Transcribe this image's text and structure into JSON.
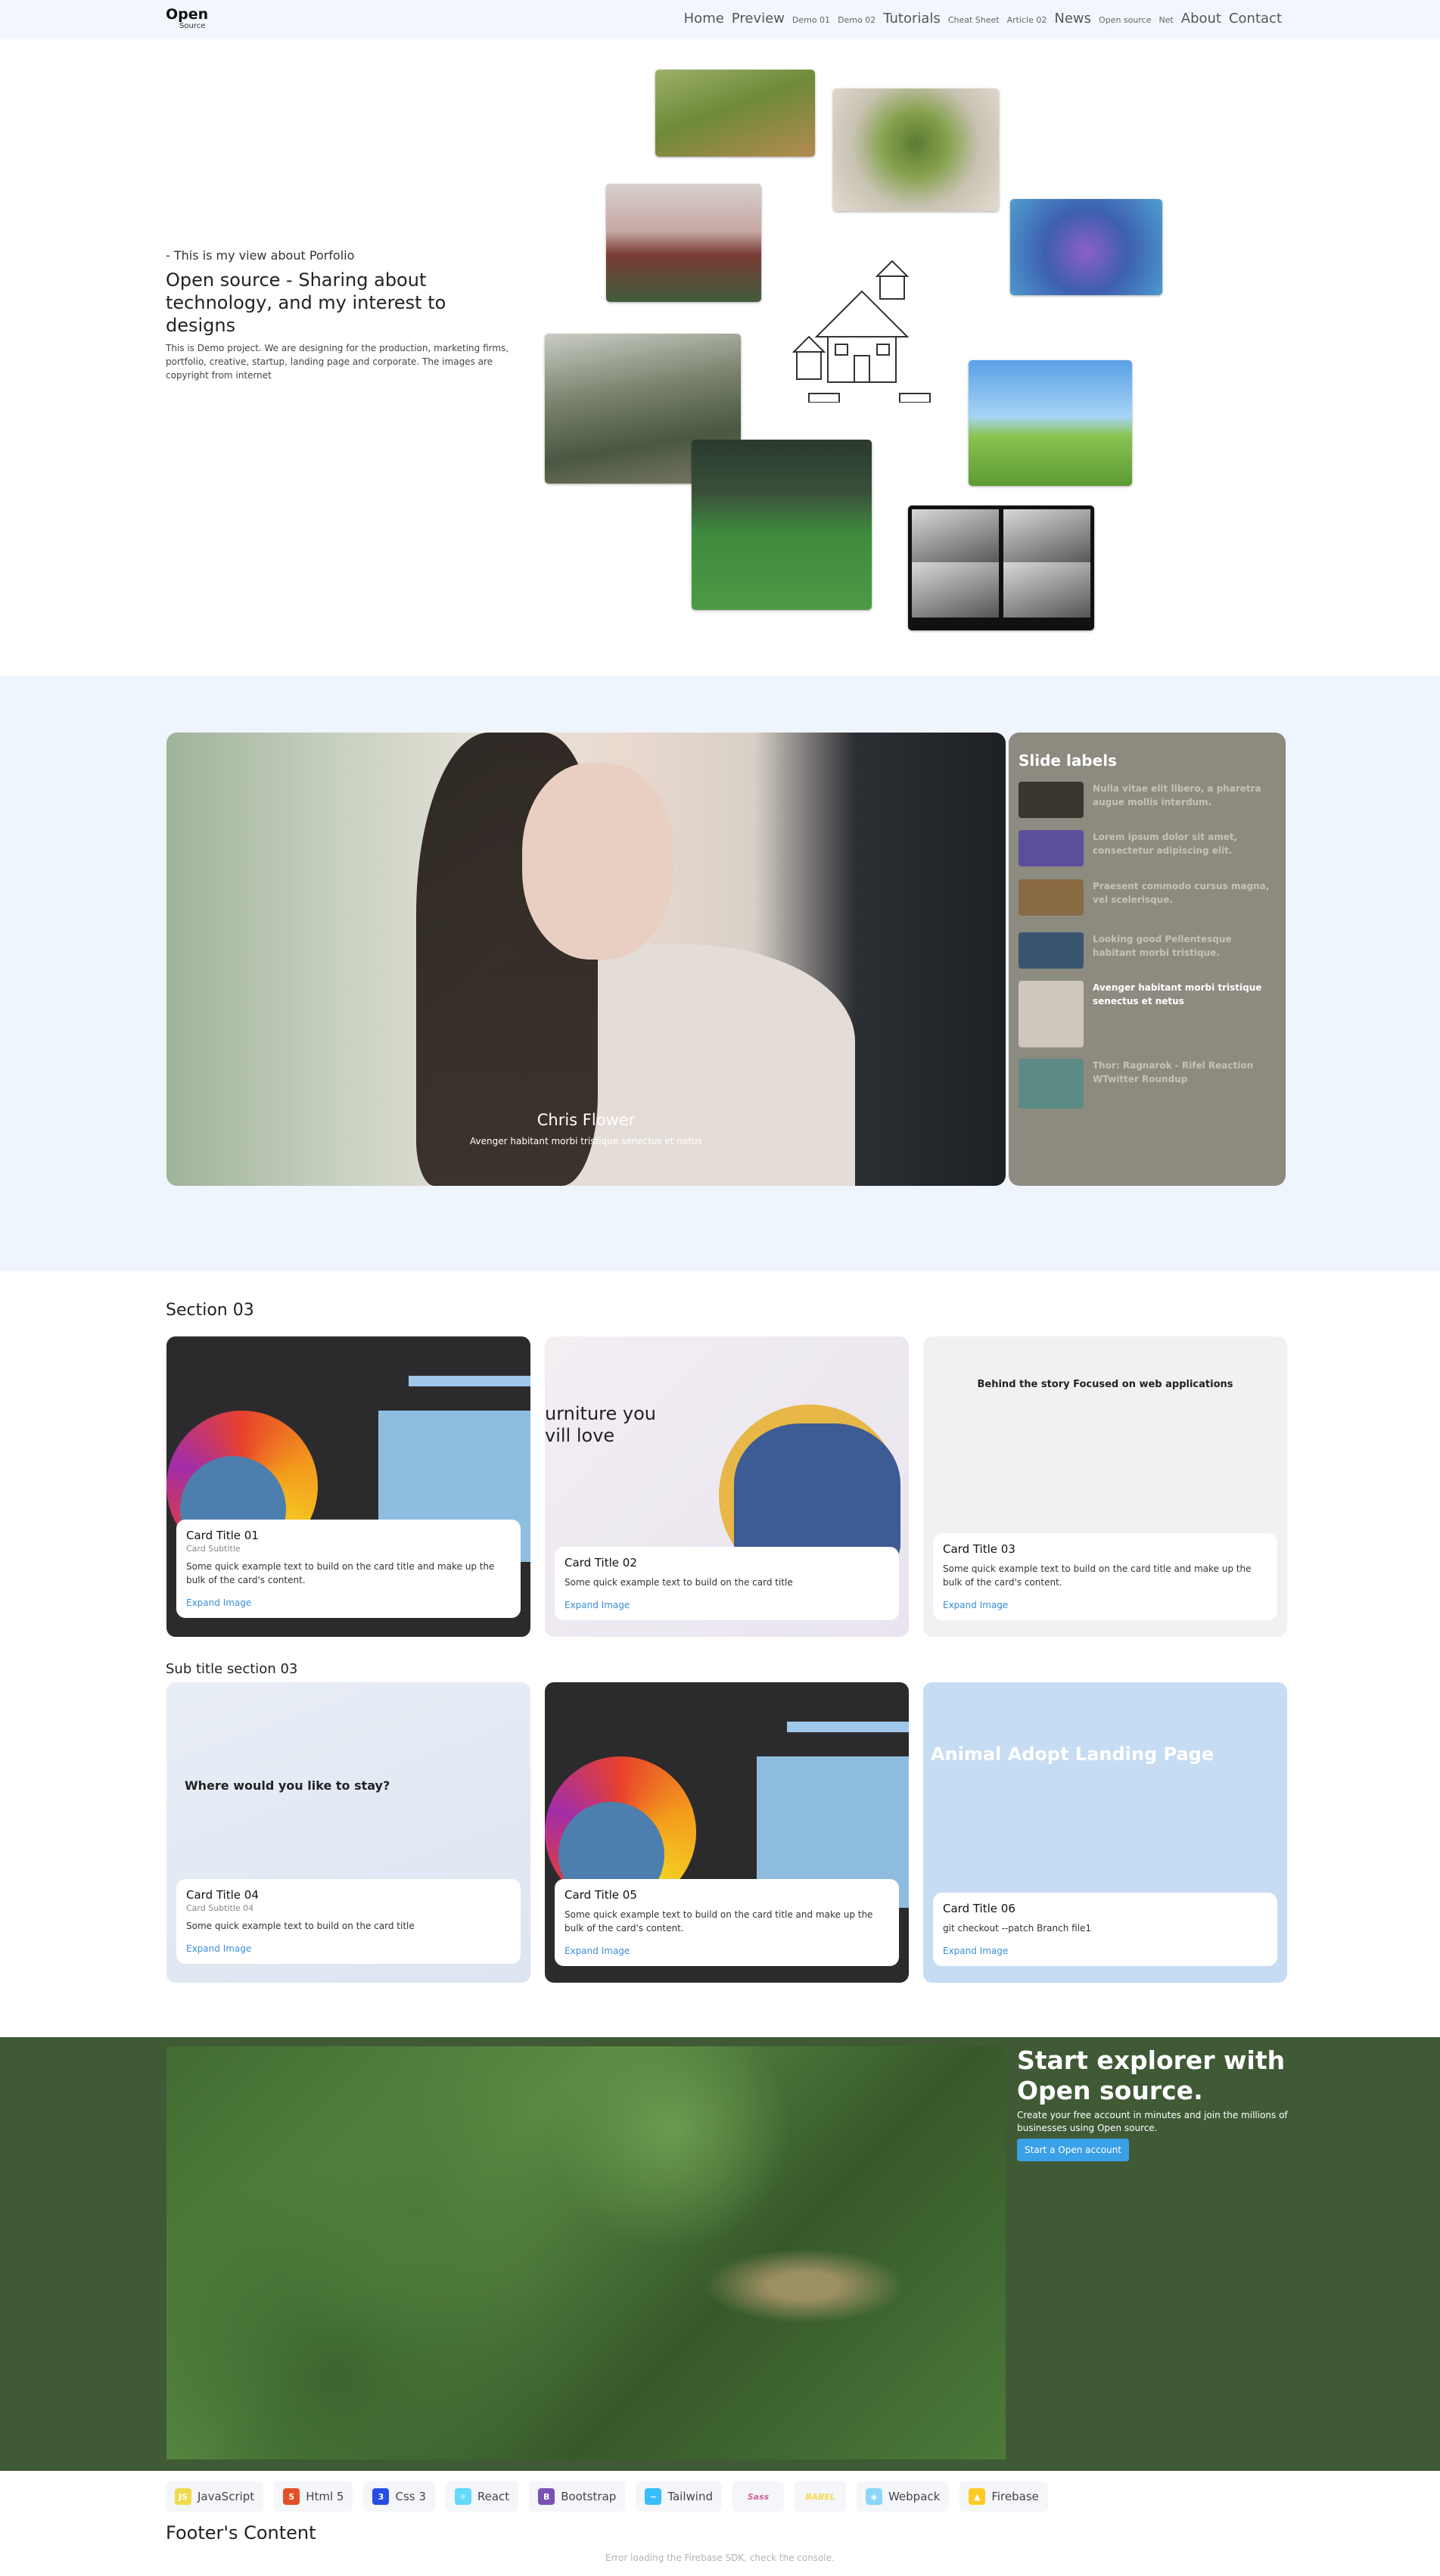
{
  "nav": {
    "logo_top": "Open",
    "logo_bottom": "Source",
    "items": [
      {
        "label": "Home",
        "size": "big"
      },
      {
        "label": "Preview",
        "size": "big"
      },
      {
        "label": "Demo 01",
        "size": "sm"
      },
      {
        "label": "Demo 02",
        "size": "sm"
      },
      {
        "label": "Tutorials",
        "size": "big"
      },
      {
        "label": "Cheat Sheet",
        "size": "sm"
      },
      {
        "label": "Article 02",
        "size": "sm"
      },
      {
        "label": "News",
        "size": "big"
      },
      {
        "label": "Open source",
        "size": "sm"
      },
      {
        "label": "Net",
        "size": "sm"
      },
      {
        "label": "About",
        "size": "big"
      },
      {
        "label": "Contact",
        "size": "big"
      }
    ]
  },
  "hero": {
    "kicker": "- This is my view about Porfolio",
    "title": "Open source - Sharing about technology, and my interest to designs",
    "description": "This is Demo project. We are designing for the production, marketing firms, portfolio, creative, startup, landing page and corporate. The images are copyright from internet"
  },
  "slider": {
    "caption_name": "Chris Flower",
    "caption_desc": "Avenger habitant morbi tristique senectus et netus",
    "panel_title": "Slide labels",
    "labels": [
      {
        "text": "Nulla vitae elit libero, a pharetra augue mollis interdum.",
        "thumb_color": "#3b3530",
        "active": false
      },
      {
        "text": "Lorem ipsum dolor sit amet, consectetur adipiscing elit.",
        "thumb_color": "#5a4f9a",
        "active": false
      },
      {
        "text": "Praesent commodo cursus magna, vel scelerisque.",
        "thumb_color": "#8a6a44",
        "active": false
      },
      {
        "text": "Looking good Pellentesque habitant morbi tristique.",
        "thumb_color": "#3a5570",
        "active": false
      },
      {
        "text": "Avenger habitant morbi tristique senectus et netus",
        "thumb_color": "#cfc7bd",
        "active": true
      },
      {
        "text": "Thor: Ragnarok - Rifel Reaction WTwitter Roundup",
        "thumb_color": "#5c8a84",
        "active": false
      }
    ]
  },
  "section03": {
    "title": "Section 03",
    "subtitle": "Sub title section 03",
    "cards": [
      {
        "title": "Card Title 01",
        "subtitle": "Card Subtitle",
        "text": "Some quick example text to build on the card title and make up the bulk of the card's content.",
        "link": "Expand Image"
      },
      {
        "title": "Card Title 02",
        "subtitle": "",
        "text": "Some quick example text to build on the card title",
        "link": "Expand Image",
        "bg_text": "urniture you\nvill love"
      },
      {
        "title": "Card Title 03",
        "subtitle": "",
        "text": "Some quick example text to build on the card title and make up the bulk of the card's content.",
        "link": "Expand Image",
        "bg_text": "Behind the story Focused on web applications"
      },
      {
        "title": "Card Title 04",
        "subtitle": "Card Subtitle 04",
        "text": "Some quick example text to build on the card title",
        "link": "Expand Image",
        "bg_text": "Where would you like to stay?"
      },
      {
        "title": "Card Title 05",
        "subtitle": "",
        "text": "Some quick example text to build on the card title and make up the bulk of the card's content.",
        "link": "Expand Image"
      },
      {
        "title": "Card Title 06",
        "subtitle": "",
        "text": "git checkout --patch Branch file1",
        "link": "Expand Image",
        "bg_text": "Animal Adopt Landing Page"
      }
    ]
  },
  "cta": {
    "title": "Start explorer with Open source.",
    "description": "Create your free account in minutes and join the millions of businesses using Open source.",
    "button": "Start a Open account"
  },
  "tech": [
    {
      "label": "JavaScript",
      "icon": "js-icon",
      "color": "#f0db4f",
      "glyph": "JS"
    },
    {
      "label": "Html 5",
      "icon": "html5-icon",
      "color": "#e34f26",
      "glyph": "5"
    },
    {
      "label": "Css 3",
      "icon": "css3-icon",
      "color": "#264de4",
      "glyph": "3"
    },
    {
      "label": "React",
      "icon": "react-icon",
      "color": "#61dafb",
      "glyph": "⚛"
    },
    {
      "label": "Bootstrap",
      "icon": "bootstrap-icon",
      "color": "#7952b3",
      "glyph": "B"
    },
    {
      "label": "Tailwind",
      "icon": "tailwind-icon",
      "color": "#38bdf8",
      "glyph": "~"
    },
    {
      "label": "",
      "icon": "sass-icon",
      "color": "#cc6699",
      "glyph": "Sass"
    },
    {
      "label": "",
      "icon": "babel-icon",
      "color": "#f5da55",
      "glyph": "BABEL"
    },
    {
      "label": "Webpack",
      "icon": "webpack-icon",
      "color": "#8dd6f9",
      "glyph": "◈"
    },
    {
      "label": "Firebase",
      "icon": "firebase-icon",
      "color": "#ffca28",
      "glyph": "▲"
    }
  ],
  "footer": {
    "title": "Footer's Content",
    "note": "Error loading the Firebase SDK, check the console."
  }
}
